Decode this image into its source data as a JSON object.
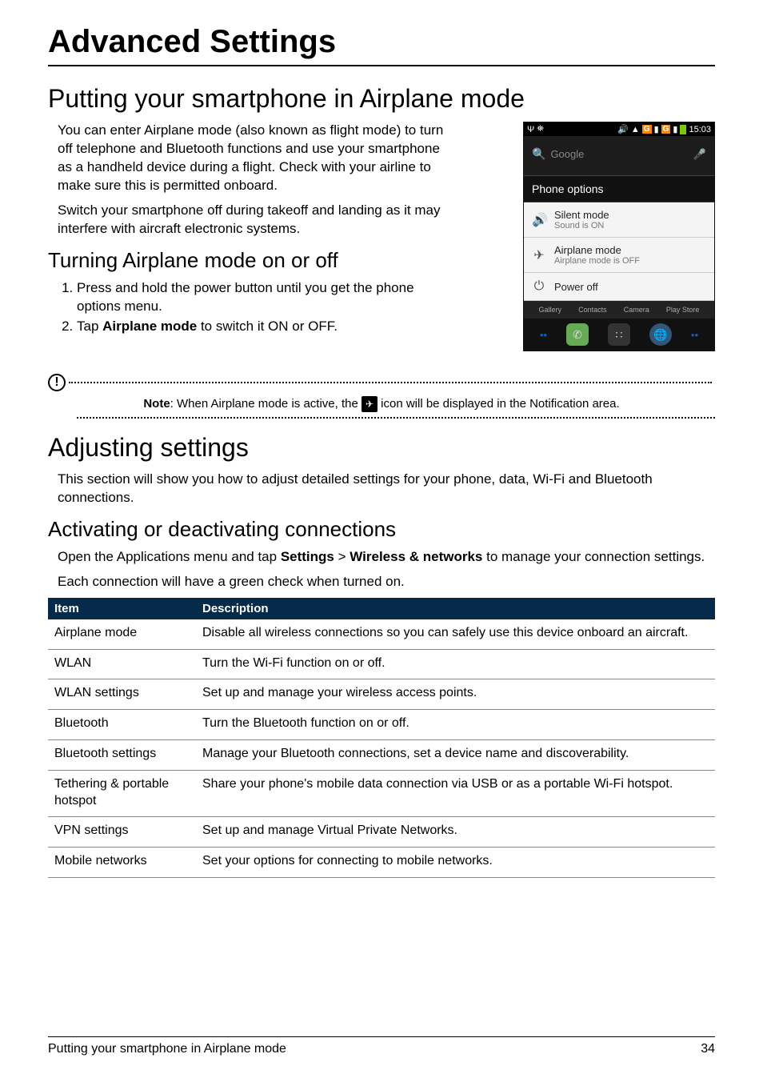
{
  "chapter_title": "Advanced Settings",
  "sec1": {
    "heading": "Putting your smartphone in Airplane mode",
    "p1": "You can enter Airplane mode (also known as flight mode) to turn off telephone and Bluetooth functions and use your smartphone as a handheld device during a flight. Check with your airline to make sure this is permitted onboard.",
    "p2": "Switch your smartphone off during takeoff and landing as it may interfere with aircraft electronic systems.",
    "sub_heading": "Turning Airplane mode on or off",
    "step1": "Press and hold the power button until you get the phone options menu.",
    "step2_a": "Tap ",
    "step2_b": "Airplane mode",
    "step2_c": " to switch it ON or OFF."
  },
  "phone": {
    "time": "15:03",
    "sig_label": "G",
    "search_placeholder": "Google",
    "options_header": "Phone options",
    "rows": [
      {
        "icon": "🔊",
        "label": "Silent mode",
        "sub": "Sound is ON"
      },
      {
        "icon": "✈",
        "label": "Airplane mode",
        "sub": "Airplane mode is OFF"
      },
      {
        "icon": "⏻",
        "label": "Power off",
        "sub": ""
      }
    ],
    "dock": [
      "Gallery",
      "Contacts",
      "Camera",
      "Play Store"
    ]
  },
  "note": {
    "pre": "Note",
    "mid_a": ": When Airplane mode is active, the ",
    "mid_b": " icon will be displayed in the Notification area."
  },
  "sec2": {
    "heading": "Adjusting settings",
    "p1": "This section will show you how to adjust detailed settings for your phone, data, Wi-Fi and Bluetooth connections.",
    "sub_heading": "Activating or deactivating connections",
    "p2_a": "Open the Applications menu and tap ",
    "p2_b": "Settings",
    "p2_c": " > ",
    "p2_d": "Wireless & networks",
    "p2_e": " to manage your connection settings.",
    "p3": "Each connection will have a green check when turned on.",
    "table": {
      "head_item": "Item",
      "head_desc": "Description",
      "rows": [
        {
          "item": "Airplane mode",
          "desc": "Disable all wireless connections so you can safely use this device onboard an aircraft."
        },
        {
          "item": "WLAN",
          "desc": "Turn the Wi-Fi function on or off."
        },
        {
          "item": "WLAN settings",
          "desc": "Set up and manage your wireless access points."
        },
        {
          "item": "Bluetooth",
          "desc": "Turn the Bluetooth function on or off."
        },
        {
          "item": "Bluetooth settings",
          "desc": "Manage your Bluetooth connections, set a device name and discoverability."
        },
        {
          "item": "Tethering & portable hotspot",
          "desc": "Share your phone's mobile data connection via USB or as a portable Wi-Fi hotspot."
        },
        {
          "item": "VPN settings",
          "desc": "Set up and manage Virtual Private Networks."
        },
        {
          "item": "Mobile networks",
          "desc": "Set your options for connecting to mobile networks."
        }
      ]
    }
  },
  "footer": {
    "left": "Putting your smartphone in Airplane mode",
    "right": "34"
  }
}
